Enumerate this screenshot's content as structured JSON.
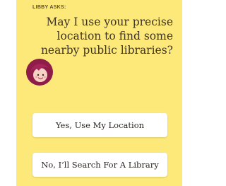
{
  "prompt": {
    "kicker": "LIBBY ASKS:",
    "question": "May I use your precise location to find some nearby public libraries?"
  },
  "actions": {
    "yes_label": "Yes, Use My Location",
    "no_label": "No, I’ll Search For A Library"
  },
  "colors": {
    "panel_background": "#fde97a",
    "button_background": "#ffffff",
    "avatar_hair": "#8e1d4a",
    "avatar_face": "#f7d2c4"
  },
  "icons": {
    "avatar": "libby-avatar-icon"
  }
}
